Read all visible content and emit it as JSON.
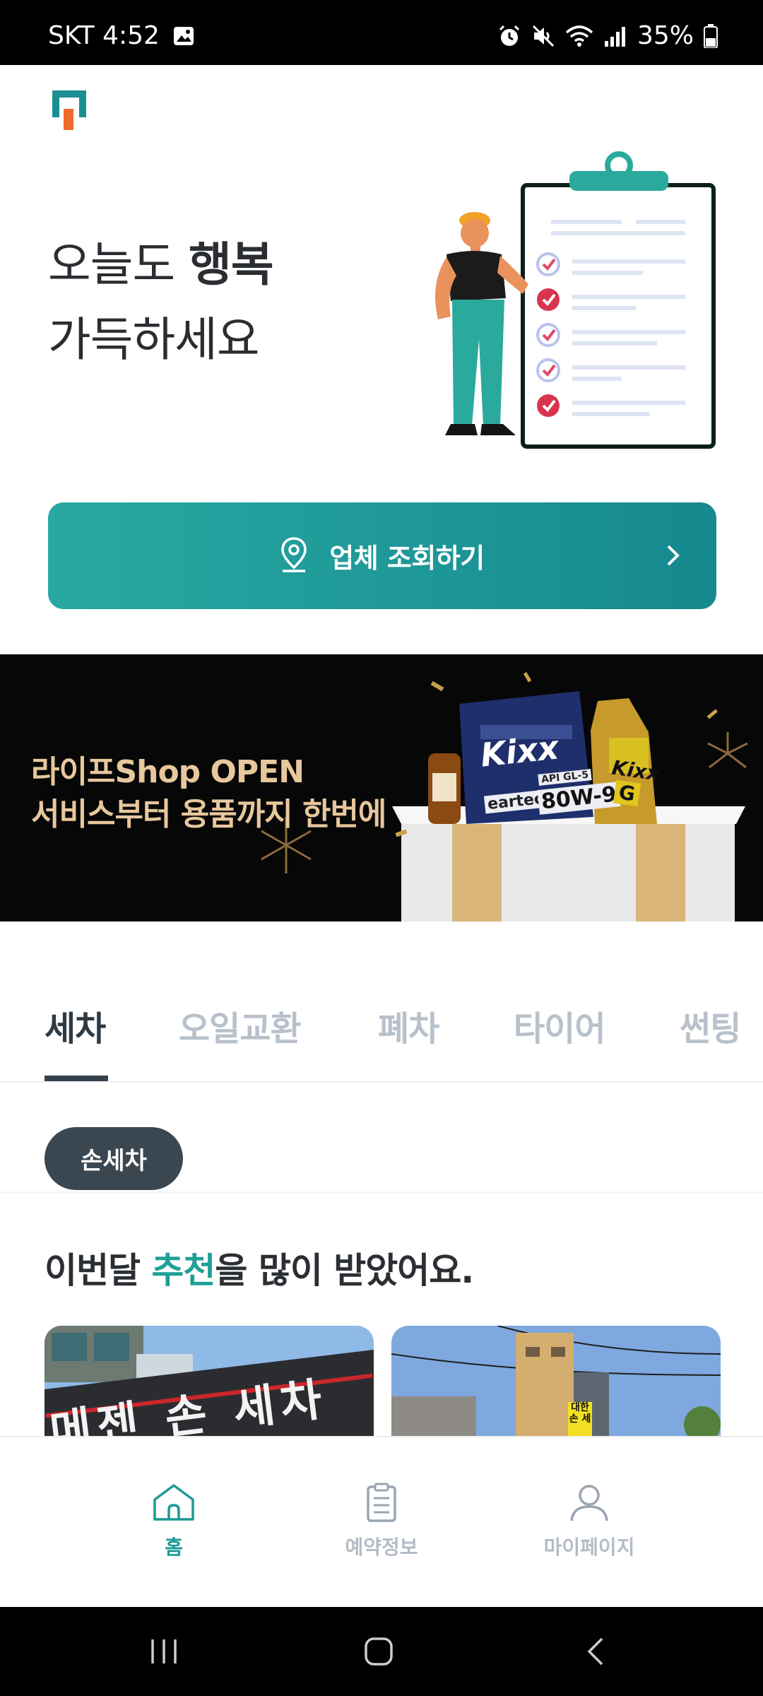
{
  "status_bar": {
    "carrier_time": "SKT 4:52",
    "battery": "35%",
    "icons": [
      "gallery-icon",
      "alarm-icon",
      "mute-icon",
      "wifi-icon",
      "signal-icon",
      "battery-icon"
    ]
  },
  "hero": {
    "greeting_line1_prefix": "오늘도 ",
    "greeting_line1_bold": "행복",
    "greeting_line2": "가득하세요"
  },
  "search_button": {
    "label": "업체 조회하기"
  },
  "banner": {
    "line1": "라이프Shop OPEN",
    "line2": "서비스부터 용품까지 한번에",
    "brand_1": "Kixx",
    "brand_2": "Kixx",
    "product_grade": "80W-9",
    "product_spec": "API GL-5",
    "product_partial": "eartec",
    "product_letter": "G"
  },
  "tabs": [
    {
      "label": "세차",
      "active": true
    },
    {
      "label": "오일교환",
      "active": false
    },
    {
      "label": "폐차",
      "active": false
    },
    {
      "label": "타이어",
      "active": false
    },
    {
      "label": "썬팅",
      "active": false
    }
  ],
  "chip": {
    "label": "손세차"
  },
  "section": {
    "title_prefix": "이번달 ",
    "title_accent": "추천",
    "title_suffix": "을 많이 받았어요."
  },
  "cards": [
    {
      "sign_text": "메젠 손 세차"
    },
    {
      "sign_text": "대한 손 세"
    }
  ],
  "bottom_nav": [
    {
      "label": "홈",
      "icon": "home-icon",
      "active": true
    },
    {
      "label": "예약정보",
      "icon": "clipboard-icon",
      "active": false
    },
    {
      "label": "마이페이지",
      "icon": "person-icon",
      "active": false
    }
  ],
  "colors": {
    "brand": "#1fa096",
    "button_start": "#28a9a3",
    "button_end": "#15898e",
    "chip": "#3a4650"
  }
}
